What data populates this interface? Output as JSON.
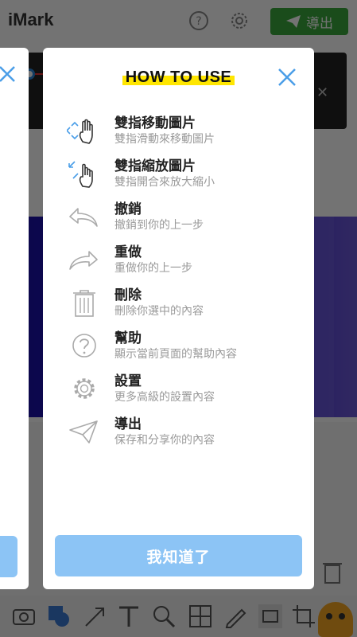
{
  "app": {
    "title": "iMark",
    "export_label": "導出",
    "icons": [
      "help-icon",
      "settings-icon",
      "send-icon"
    ],
    "toolbar_icons": [
      "camera-icon",
      "shapes-icon",
      "arrow-icon",
      "text-icon",
      "magnifier-icon",
      "grid-icon",
      "pen-icon",
      "rectangle-icon",
      "crop-icon"
    ]
  },
  "dialog": {
    "title": "HOW TO USE",
    "confirm_label": "我知道了",
    "items": [
      {
        "icon": "two-finger-move-icon",
        "title": "雙指移動圖片",
        "desc": "雙指滑動來移動圖片"
      },
      {
        "icon": "two-finger-zoom-icon",
        "title": "雙指縮放圖片",
        "desc": "雙指開合來放大縮小"
      },
      {
        "icon": "undo-icon",
        "title": "撤銷",
        "desc": "撤銷到你的上一步"
      },
      {
        "icon": "redo-icon",
        "title": "重做",
        "desc": "重做你的上一步"
      },
      {
        "icon": "trash-icon",
        "title": "刪除",
        "desc": "刪除你選中的內容"
      },
      {
        "icon": "help-icon",
        "title": "幫助",
        "desc": "顯示當前頁面的幫助內容"
      },
      {
        "icon": "gear-icon",
        "title": "設置",
        "desc": "更多高級的設置內容"
      },
      {
        "icon": "send-icon",
        "title": "導出",
        "desc": "保存和分享你的內容"
      }
    ]
  },
  "colors": {
    "accent_blue": "#8cc4f5",
    "close_blue": "#4a9ee8",
    "highlight_yellow": "#ffe600",
    "export_green": "#3aa83c"
  }
}
